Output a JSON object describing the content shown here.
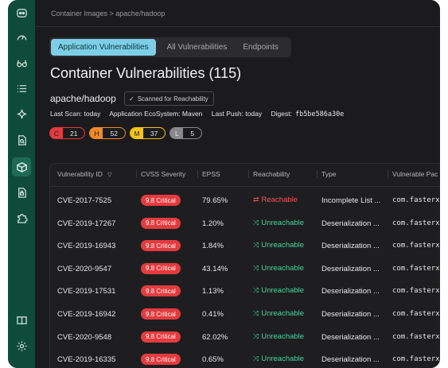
{
  "breadcrumb": "Container Images > apache/hadoop",
  "tabs": [
    "Application Vulnerabilities",
    "All Vulnerabilities",
    "Endpoints"
  ],
  "title": "Container Vulnerabilities (115)",
  "repo": "apache/hadoop",
  "scanned_label": "Scanned for Reachability",
  "meta": {
    "last_scan": "Last Scan: today",
    "ecosystem": "Application EcoSystem: Maven",
    "last_push": "Last Push: today",
    "digest_label": "Digest:",
    "digest_value": "fb5be586a30e"
  },
  "severity_counts": [
    {
      "letter": "C",
      "count": "21",
      "color": "#e43b3e"
    },
    {
      "letter": "H",
      "count": "52",
      "color": "#f08a24"
    },
    {
      "letter": "M",
      "count": "37",
      "color": "#f5c518"
    },
    {
      "letter": "L",
      "count": "5",
      "color": "#8a8a8e"
    }
  ],
  "table": {
    "headers": [
      "Vulnerability ID",
      "CVSS Severity",
      "EPSS",
      "Reachability",
      "Type",
      "Vulnerable Pac"
    ],
    "sort_icon": "▽",
    "rows": [
      {
        "id": "CVE-2017-7525",
        "severity": "9.8 Critical",
        "epss": "79.65%",
        "reach": "Reachable",
        "type": "Incomplete List ...",
        "pkg": "com.fasterx"
      },
      {
        "id": "CVE-2019-17267",
        "severity": "9.8 Critical",
        "epss": "1.20%",
        "reach": "Unreachable",
        "type": "Deserialization ...",
        "pkg": "com.fasterx"
      },
      {
        "id": "CVE-2019-16943",
        "severity": "9.8 Critical",
        "epss": "1.84%",
        "reach": "Unreachable",
        "type": "Deserialization ...",
        "pkg": "com.fasterx"
      },
      {
        "id": "CVE-2020-9547",
        "severity": "9.8 Critical",
        "epss": "43.14%",
        "reach": "Unreachable",
        "type": "Deserialization ...",
        "pkg": "com.fasterx"
      },
      {
        "id": "CVE-2019-17531",
        "severity": "9.8 Critical",
        "epss": "1.13%",
        "reach": "Unreachable",
        "type": "Deserialization ...",
        "pkg": "com.fasterx"
      },
      {
        "id": "CVE-2019-16942",
        "severity": "9.8 Critical",
        "epss": "0.41%",
        "reach": "Unreachable",
        "type": "Deserialization ...",
        "pkg": "com.fasterx"
      },
      {
        "id": "CVE-2020-9548",
        "severity": "9.8 Critical",
        "epss": "62.02%",
        "reach": "Unreachable",
        "type": "Deserialization ...",
        "pkg": "com.fasterx"
      },
      {
        "id": "CVE-2019-16335",
        "severity": "9.8 Critical",
        "epss": "0.65%",
        "reach": "Unreachable",
        "type": "Deserialization ...",
        "pkg": "com.fasterx"
      }
    ]
  },
  "colors": {
    "reachable": "#f0555a",
    "unreachable": "#4ad29a",
    "accent_tab": "#7ccfe6",
    "sidebar": "#0f4b3a"
  },
  "sidebar_icons": [
    "logo-icon",
    "dashboard-gauge-icon",
    "glasses-icon",
    "list-icon",
    "sparkle-icon",
    "file-search-icon",
    "container-box-icon",
    "file-lock-icon",
    "puzzle-icon",
    "book-icon",
    "gear-icon"
  ]
}
